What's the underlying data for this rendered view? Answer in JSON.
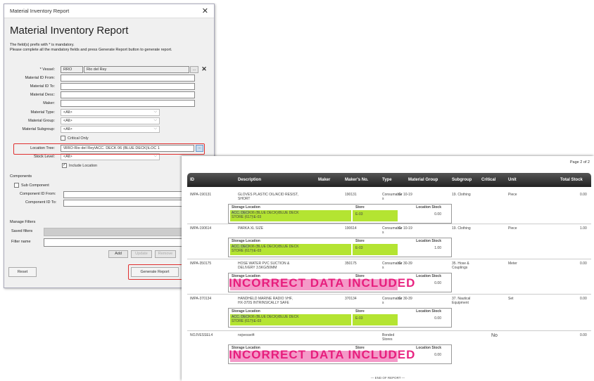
{
  "dialog": {
    "window_title": "Material Inventory Report",
    "heading": "Material Inventory Report",
    "note1": "The field(s) prefix with * is mandatory.",
    "note2": "Please complete all the mandatory fields and press Generate Report button to generate report.",
    "vessel_label": "* Vessel:",
    "vessel_code": "RRO",
    "vessel_name": "Rio del Rey",
    "vessel_btn": "...",
    "clear_btn": "✕",
    "mat_from_label": "Material ID From:",
    "mat_to_label": "Material ID To:",
    "mat_desc_label": "Material Desc:",
    "maker_label": "Maker:",
    "type_label": "Material Type:",
    "type_value": "<All>",
    "group_label": "Material Group:",
    "group_value": "<All>",
    "subgroup_label": "Material Subgroup:",
    "subgroup_value": "<All>",
    "critical_label": "Critical Only",
    "location_label": "Location Tree:",
    "location_value": "\\RRO-Rio del Rey\\ACC. DECK 06 (BLUE DECK)\\LOC 1",
    "location_btn": "...",
    "stock_label": "Stock Level:",
    "stock_value": "<All>",
    "include_location_label": "Include Location",
    "components_title": "Components",
    "sub_component_label": "Sub Component",
    "comp_from_label": "Component ID From:",
    "comp_to_label": "Component ID To:",
    "manage_title": "Manage Filters",
    "saved_label": "Saved filters",
    "filter_name_label": "Filter name",
    "add_btn": "Add",
    "update_btn": "Update",
    "remove_btn": "Remove",
    "reset_btn": "Reset",
    "generate_btn": "Generate Report"
  },
  "report": {
    "page_label": "Page 2 of 2",
    "headers": {
      "id": "ID",
      "description": "Description",
      "maker": "Maker",
      "makers_no": "Maker's No.",
      "type": "Type",
      "group": "Material Group",
      "subgroup": "Subgroup",
      "critical": "Critical",
      "unit": "Unit",
      "total": "Total Stock"
    },
    "sub_headers": {
      "storage": "Storage Location",
      "store": "Store",
      "loc_stock": "Location Stock"
    },
    "rows": [
      {
        "id": "IMPA-190131",
        "desc1": "GLOVES PLASTIC OIL/ACID RESIST,",
        "desc2": "SHORT",
        "makers_no": "190131",
        "type1": "Consumable",
        "type2": "s",
        "group": "Gr 10-19",
        "sub1": "19. Clothing",
        "sub2": "",
        "critical": "",
        "unit": "Piece",
        "total": "0.00",
        "loc1": "ACC. DECK06 (BLUE DECK)\\BLUE DECK",
        "loc2": "STORE (617)\\E-03",
        "store": "E-03",
        "qty": "0.00"
      },
      {
        "id": "IMPA-190614",
        "desc1": "PARKA XL SIZE",
        "desc2": "",
        "makers_no": "190614",
        "type1": "Consumable",
        "type2": "s",
        "group": "Gr 10-19",
        "sub1": "19. Clothing",
        "sub2": "",
        "critical": "",
        "unit": "Piece",
        "total": "1.00",
        "loc1": "ACC. DECK06 (BLUE DECK)\\BLUE DECK",
        "loc2": "STORE (617)\\E-03",
        "store": "E-03",
        "qty": "1.00"
      },
      {
        "id": "IMPA-350175",
        "desc1": "HOSE WATER PVC SUCTION &",
        "desc2": "DELIVERY 3.5KG/50MM",
        "makers_no": "350175",
        "type1": "Consumable",
        "type2": "s",
        "group": "Gr 30-39",
        "sub1": "35. Hose &",
        "sub2": "Couplings",
        "critical": "",
        "unit": "Meter",
        "total": "0.00",
        "watermark": "INCORRECT DATA INCLUDED",
        "qty": "0.00"
      },
      {
        "id": "IMPA-370134",
        "desc1": "HANDHELD MARINE RADIO VHF,",
        "desc2": "HX-370S INTRINSICALLY SAFE",
        "makers_no": "370134",
        "type1": "Consumable",
        "type2": "s",
        "group": "Gr 30-39",
        "sub1": "37. Nautical",
        "sub2": "Equipment",
        "critical": "",
        "unit": "Set",
        "total": "0.00",
        "loc1": "ACC. DECK06 (BLUE DECK)\\BLUE DECK",
        "loc2": "STORE (617)\\E-03",
        "store": "E-03",
        "qty": "0.00"
      },
      {
        "id": "NOJVESSEL4",
        "desc1": "nojvessel4",
        "desc2": "",
        "makers_no": "",
        "type1": "Bonded",
        "type2": "Stores",
        "group": "",
        "sub1": "",
        "sub2": "",
        "critical": "No",
        "unit": "",
        "total": "0.00",
        "watermark": "INCORRECT DATA INCLUDED",
        "qty": "0.00"
      }
    ],
    "end_label": "— END OF REPORT —"
  },
  "colors": {
    "highlight_red": "#e03030",
    "green": "#b4e432",
    "pink": "#f49ac8",
    "watermark": "#e7187a"
  }
}
